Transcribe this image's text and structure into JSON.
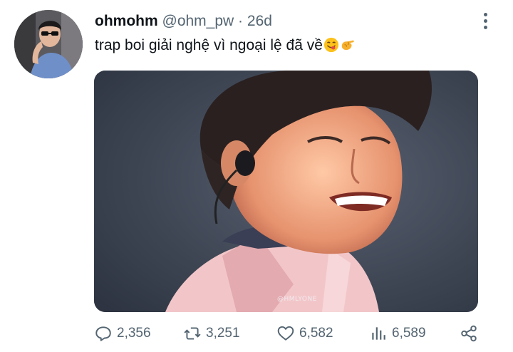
{
  "tweet": {
    "display_name": "ohmohm",
    "handle": "@ohm_pw",
    "separator": "·",
    "time_ago": "26d",
    "text": "trap boi giải nghệ vì ngoại lệ đã về",
    "emojis": [
      "yum-face-emoji",
      "pinching-hand-emoji"
    ],
    "media": {
      "watermark": "@HMLYONE",
      "description_icon": "photo"
    }
  },
  "actions": {
    "replies": "2,356",
    "retweets": "3,251",
    "likes": "6,582",
    "views": "6,589"
  },
  "icons": {
    "more": "more-vertical-icon",
    "reply": "reply-icon",
    "retweet": "retweet-icon",
    "like": "heart-icon",
    "views": "views-icon",
    "share": "share-icon"
  },
  "colors": {
    "text": "#0f1419",
    "secondary": "#536471",
    "background": "#ffffff"
  }
}
